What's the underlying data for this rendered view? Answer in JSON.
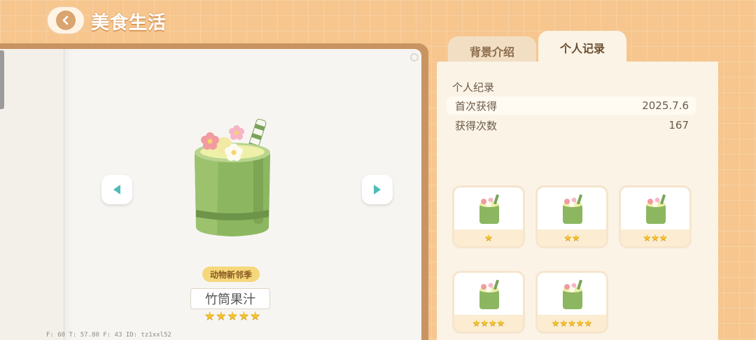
{
  "header": {
    "title": "美食生活",
    "back_icon": "chevron-left-icon"
  },
  "item": {
    "season_badge": "动物新邻季",
    "name": "竹筒果汁",
    "stars": "★★★★★"
  },
  "debug": "F: 60   T: 57.80   F: 43   ID: tz1xxl52",
  "tabs": [
    {
      "label": "背景介绍",
      "active": false
    },
    {
      "label": "个人记录",
      "active": true
    }
  ],
  "record": {
    "heading": "个人纪录",
    "rows": [
      {
        "label": "首次获得",
        "value": "2025.7.6"
      },
      {
        "label": "获得次数",
        "value": "167"
      }
    ]
  },
  "variants": [
    {
      "stars": "★"
    },
    {
      "stars": "★★"
    },
    {
      "stars": "★★★"
    },
    {
      "stars": "★★★★"
    },
    {
      "stars": "★★★★★"
    }
  ],
  "colors": {
    "accent_teal": "#4fbcb6",
    "star_gold": "#f2c230",
    "bamboo_green": "#7aa35a"
  }
}
